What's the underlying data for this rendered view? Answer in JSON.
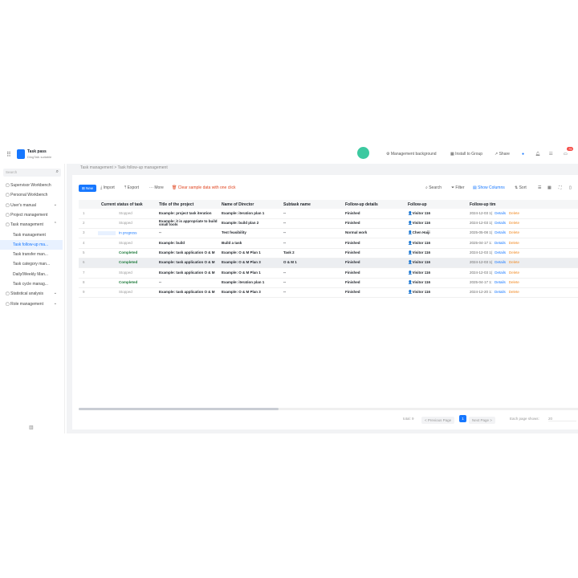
{
  "header": {
    "app_name": "Task pass",
    "app_subtitle": "DingTalk suitable",
    "items": [
      "Management background",
      "Install to Group",
      "Share"
    ],
    "notification_count": "75"
  },
  "sidebar": {
    "search_placeholder": "Search",
    "items": [
      {
        "label": "Supervisor Workbench",
        "level": 1
      },
      {
        "label": "Personal Workbench",
        "level": 1
      },
      {
        "label": "User's manual",
        "level": 1,
        "chevron": "v"
      },
      {
        "label": "Project management",
        "level": 1
      },
      {
        "label": "Task management",
        "level": 1,
        "chevron": "^"
      },
      {
        "label": "Task management",
        "level": 2
      },
      {
        "label": "Task follow-up ma...",
        "level": 2,
        "active": true
      },
      {
        "label": "Task transfer man...",
        "level": 2
      },
      {
        "label": "Task category man...",
        "level": 2
      },
      {
        "label": "Daily/Weekly Man...",
        "level": 2
      },
      {
        "label": "Task cycle manag...",
        "level": 2
      },
      {
        "label": "Statistical analysis",
        "level": 1,
        "chevron": "v"
      },
      {
        "label": "Role management",
        "level": 1,
        "chevron": "v"
      }
    ]
  },
  "breadcrumb": [
    "Task management",
    "Task follow-up management"
  ],
  "toolbar": {
    "new": "New",
    "import": "Import",
    "export": "Export",
    "more": "More",
    "clear": "Clear sample data with one click",
    "search": "Search",
    "filter": "Filter",
    "show_columns": "Show Columns",
    "sort": "Sort"
  },
  "table": {
    "columns": [
      "Current status of task",
      "Title of the project",
      "Name of Director",
      "Subtask name",
      "Follow-up details",
      "Follow-up",
      "Follow-up tim"
    ],
    "actions": {
      "details": "Details",
      "delete": "Delete"
    },
    "rows": [
      {
        "idx": "1",
        "status": "Stopped",
        "title": "Example: project task iteration",
        "director": "Example: iteration plan 1",
        "subtask": "--",
        "details": "Finished",
        "person": "Visitor 116",
        "time": "2024-12-03 1("
      },
      {
        "idx": "2",
        "status": "Stopped",
        "title": "Example: it is appropriate to build small tools",
        "director": "Example: build plan 2",
        "subtask": "--",
        "details": "Finished",
        "person": "Visitor 116",
        "time": "2024-12-03 1("
      },
      {
        "idx": "3",
        "status": "In progress",
        "title": "--",
        "director": "Test feasibility",
        "subtask": "--",
        "details": "Normal work",
        "person": "Chen Haiji",
        "time": "2025-05-08 1("
      },
      {
        "idx": "4",
        "status": "Stopped",
        "title": "Example: build",
        "director": "Build a task",
        "subtask": "--",
        "details": "Finished",
        "person": "Visitor 116",
        "time": "2025-04-17 1:"
      },
      {
        "idx": "5",
        "status": "Completed",
        "title": "Example: task application O & M",
        "director": "Example: O & M Plan 1",
        "subtask": "Task 2",
        "details": "Finished",
        "person": "Visitor 116",
        "time": "2024-12-03 1("
      },
      {
        "idx": "6",
        "status": "Completed",
        "title": "Example: task application O & M",
        "director": "Example: O & M Plan 3",
        "subtask": "O & M 1",
        "details": "Finished",
        "person": "Visitor 116",
        "time": "2024-12-03 1(",
        "highlighted": true
      },
      {
        "idx": "7",
        "status": "Stopped",
        "title": "Example: task application O & M",
        "director": "Example: O & M Plan 1",
        "subtask": "--",
        "details": "Finished",
        "person": "Visitor 116",
        "time": "2024-12-03 1("
      },
      {
        "idx": "8",
        "status": "Completed",
        "title": "--",
        "director": "Example: iteration plan 1",
        "subtask": "--",
        "details": "Finished",
        "person": "Visitor 116",
        "time": "2025-04-17 1:"
      },
      {
        "idx": "9",
        "status": "Stopped",
        "title": "Example: task application O & M",
        "director": "Example: O & M Plan 3",
        "subtask": "--",
        "details": "Finished",
        "person": "Visitor 116",
        "time": "2024-12-20 1:"
      }
    ]
  },
  "pagination": {
    "total": "total: 9",
    "prev": "< Previous Page",
    "current": "1",
    "next": "Next Page >",
    "page_size_label": "Each page shows:",
    "page_size": "20"
  }
}
